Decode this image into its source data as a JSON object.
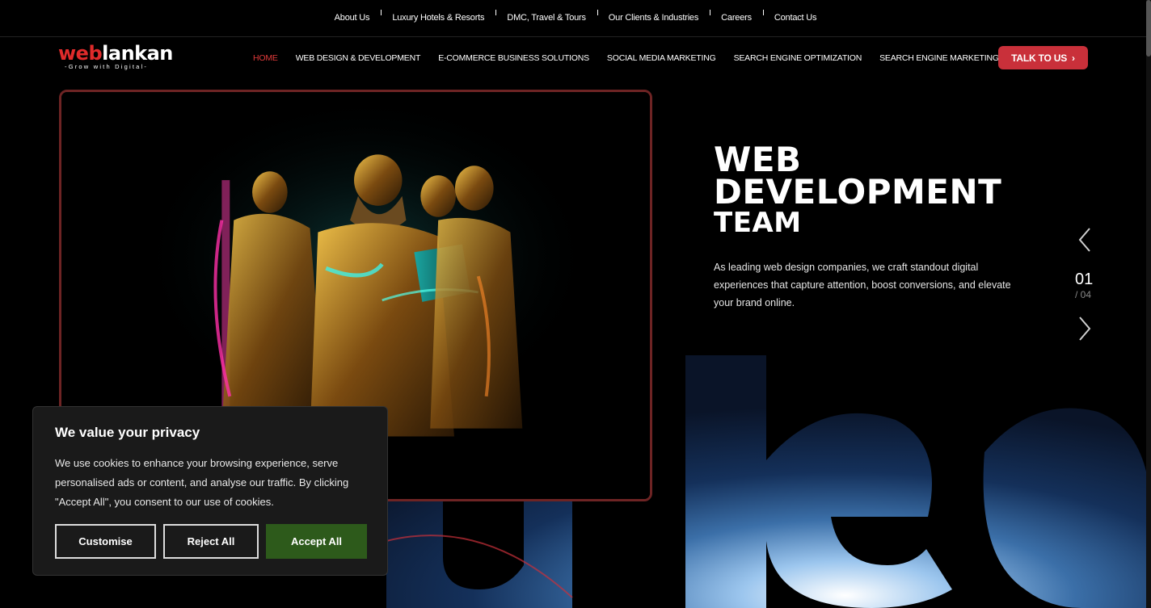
{
  "topbar": {
    "links": [
      "About Us",
      "Luxury Hotels & Resorts",
      "DMC, Travel & Tours",
      "Our Clients & Industries",
      "Careers",
      "Contact Us"
    ]
  },
  "logo": {
    "part1": "web",
    "part2": "lankan",
    "tagline": "-Grow with Digital-"
  },
  "nav": {
    "items": [
      "HOME",
      "WEB DESIGN & DEVELOPMENT",
      "E-COMMERCE BUSINESS SOLUTIONS",
      "SOCIAL MEDIA MARKETING",
      "SEARCH ENGINE OPTIMIZATION",
      "SEARCH ENGINE MARKETING"
    ],
    "active_index": 0
  },
  "cta": {
    "label": "TALK TO US",
    "chevron": "›"
  },
  "hero": {
    "title_line1": "WEB",
    "title_line2": "DEVELOPMENT",
    "title_line3": "TEAM",
    "description": "As leading web design companies, we craft standout digital experiences that capture attention, boost conversions, and elevate your brand online.",
    "image_icon": "statues-laptop-illustration"
  },
  "slider": {
    "current": "01",
    "total": "/ 04",
    "prev_icon": "chevron-left-icon",
    "next_icon": "chevron-right-icon"
  },
  "cookie": {
    "title": "We value your privacy",
    "body": "We use cookies to enhance your browsing experience, serve personalised ads or content, and analyse our traffic. By clicking \"Accept All\", you consent to our use of cookies.",
    "customise": "Customise",
    "reject": "Reject All",
    "accept": "Accept All"
  },
  "colors": {
    "accent": "#e03a3a",
    "cta": "#c9303a",
    "frame": "#6e2424",
    "accept": "#2d5a1b"
  }
}
